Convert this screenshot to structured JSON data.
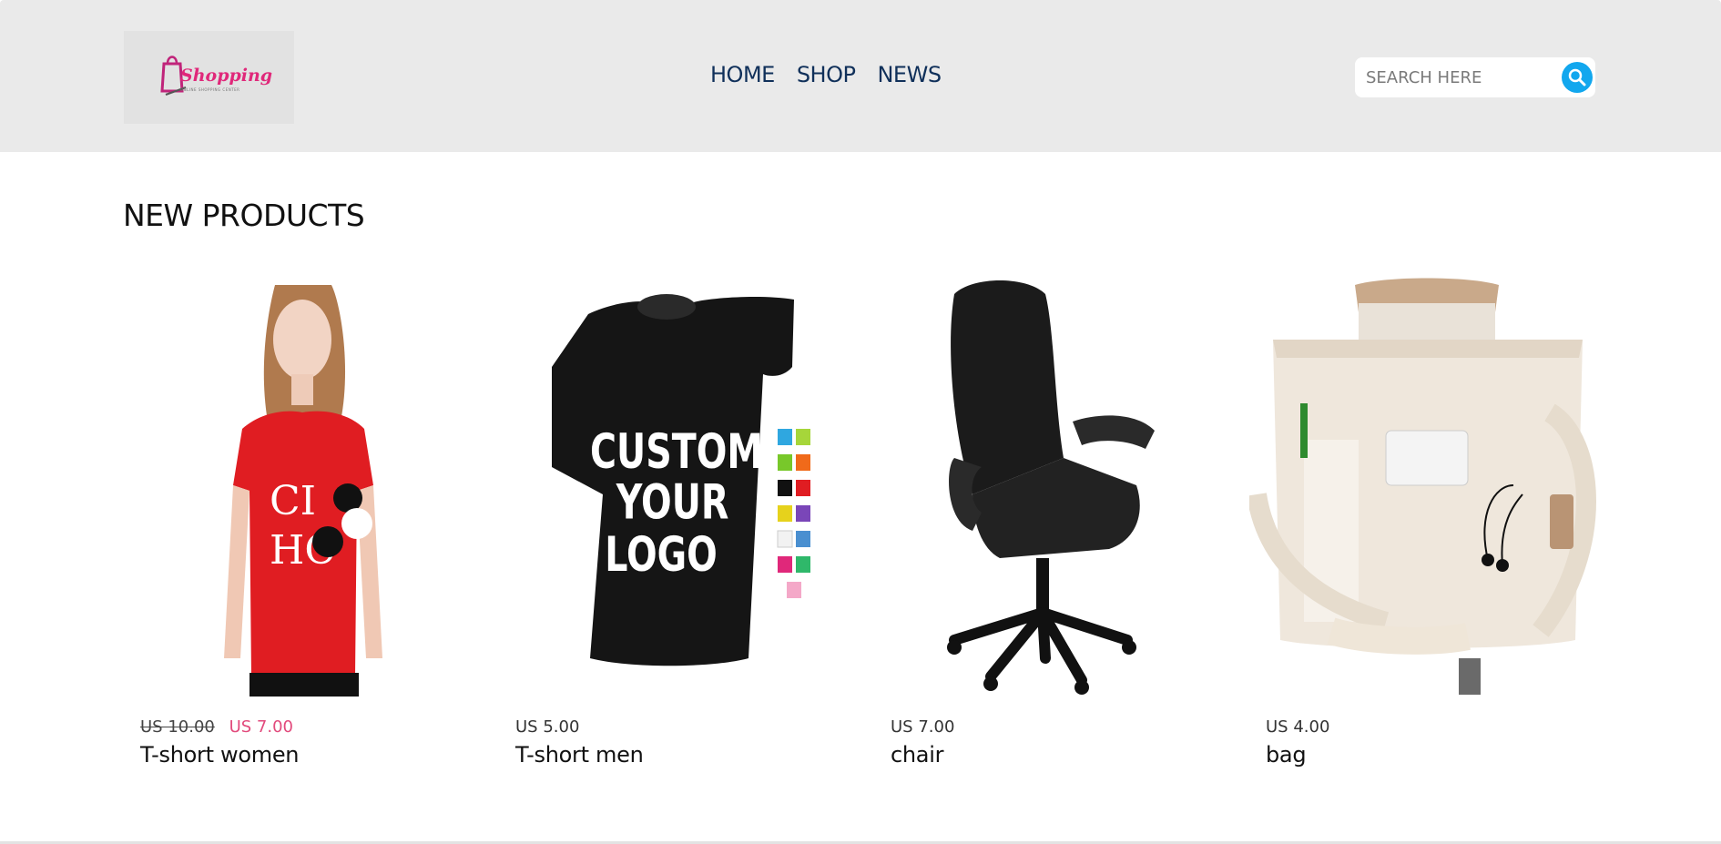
{
  "header": {
    "logo_text": "Shopping",
    "logo_tagline": "ONLINE SHOPPING CENTER",
    "nav": [
      "HOME",
      "SHOP",
      "NEWS"
    ],
    "search": {
      "placeholder": "SEARCH HERE",
      "icon": "search-icon"
    }
  },
  "main": {
    "section_title": "NEW PRODUCTS",
    "products": [
      {
        "name": "T-short women",
        "old_price": "US 10.00",
        "price": "US 7.00",
        "on_sale": true,
        "image": "woman-red-tshirt"
      },
      {
        "name": "T-short men",
        "price": "US 5.00",
        "on_sale": false,
        "image": "black-custom-tshirt",
        "image_text": [
          "CUSTOM",
          "YOUR",
          "LOGO"
        ]
      },
      {
        "name": "chair",
        "price": "US 7.00",
        "on_sale": false,
        "image": "black-office-chair"
      },
      {
        "name": "bag",
        "price": "US 4.00",
        "on_sale": false,
        "image": "beige-tote-bag"
      }
    ]
  },
  "colors": {
    "header_bg": "#eaeaea",
    "nav_text": "#10305a",
    "search_button": "#12a7ee",
    "sale_price": "#e24a7c",
    "logo": "#e0287a"
  }
}
